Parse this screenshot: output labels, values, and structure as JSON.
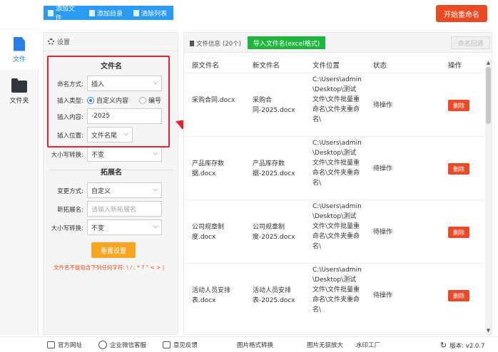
{
  "toolbar": {
    "add_file": "添加文件",
    "add_dir": "添加目录",
    "clear_list": "清除列表",
    "start_rename": "开始重命名"
  },
  "nav": {
    "items": [
      {
        "label": "文件",
        "icon": "file-icon"
      },
      {
        "label": "文件夹",
        "icon": "folder-icon"
      }
    ]
  },
  "settings": {
    "title": "设置",
    "filename_section": "文件名",
    "naming_label": "命名方式:",
    "naming_value": "插入",
    "insert_type_label": "插入类型:",
    "insert_type_opt1": "自定义内容",
    "insert_type_opt2": "编号",
    "insert_content_label": "插入内容:",
    "insert_content_value": "-2025",
    "insert_pos_label": "插入位置:",
    "insert_pos_value": "文件名尾",
    "case_label": "大小写转换:",
    "case_value": "不变",
    "ext_section": "拓展名",
    "change_label": "变更方式:",
    "change_value": "自定义",
    "new_ext_label": "新拓展名:",
    "new_ext_placeholder": "请输入新拓展名",
    "case2_label": "大小写转换:",
    "case2_value": "不变",
    "reset": "重置设置",
    "warning": "文件名不能包含下列任何字符: \\ / : * ? \" < > |"
  },
  "files": {
    "info_label": "文件信息",
    "count": "(20个)",
    "import_btn": "导入文件名(excel格式)",
    "rollback_btn": "命名回退",
    "columns": [
      "原文件名",
      "新文件名",
      "文件位置",
      "状态",
      "操作"
    ],
    "rows": [
      {
        "orig": "采购合同.docx",
        "new": "采购合同-2025.docx",
        "path": "C:\\Users\\admin\\Desktop\\测试文件\\文件批量重命名\\文件夹重命名\\",
        "status": "待操作",
        "action": "删除"
      },
      {
        "orig": "产品库存数据.docx",
        "new": "产品库存数据-2025.docx",
        "path": "C:\\Users\\admin\\Desktop\\测试文件\\文件批量重命名\\文件夹重命名\\",
        "status": "待操作",
        "action": "删除"
      },
      {
        "orig": "公司规章制度.docx",
        "new": "公司规章制度-2025.docx",
        "path": "C:\\Users\\admin\\Desktop\\测试文件\\文件批量重命名\\文件夹重命名\\",
        "status": "待操作",
        "action": "删除"
      },
      {
        "orig": "活动人员安排表.docx",
        "new": "活动人员安排表-2025.docx",
        "path": "C:\\Users\\admin\\Desktop\\测试文件\\文件批量重命名\\文件夹重命名\\",
        "status": "待操作",
        "action": "删除"
      }
    ]
  },
  "footer": {
    "website": "官方网址",
    "wechat": "企业微信客服",
    "feedback": "意见反馈",
    "img_convert": "图片格式转换",
    "img_enlarge": "图片无损放大",
    "watermark": "水印工厂",
    "version": "版本: v2.0.7"
  },
  "colors": {
    "accent": "#2b9af3",
    "danger": "#ea4a23",
    "success": "#1db53b",
    "warning": "#f5a623",
    "highlight": "#e0252b"
  }
}
